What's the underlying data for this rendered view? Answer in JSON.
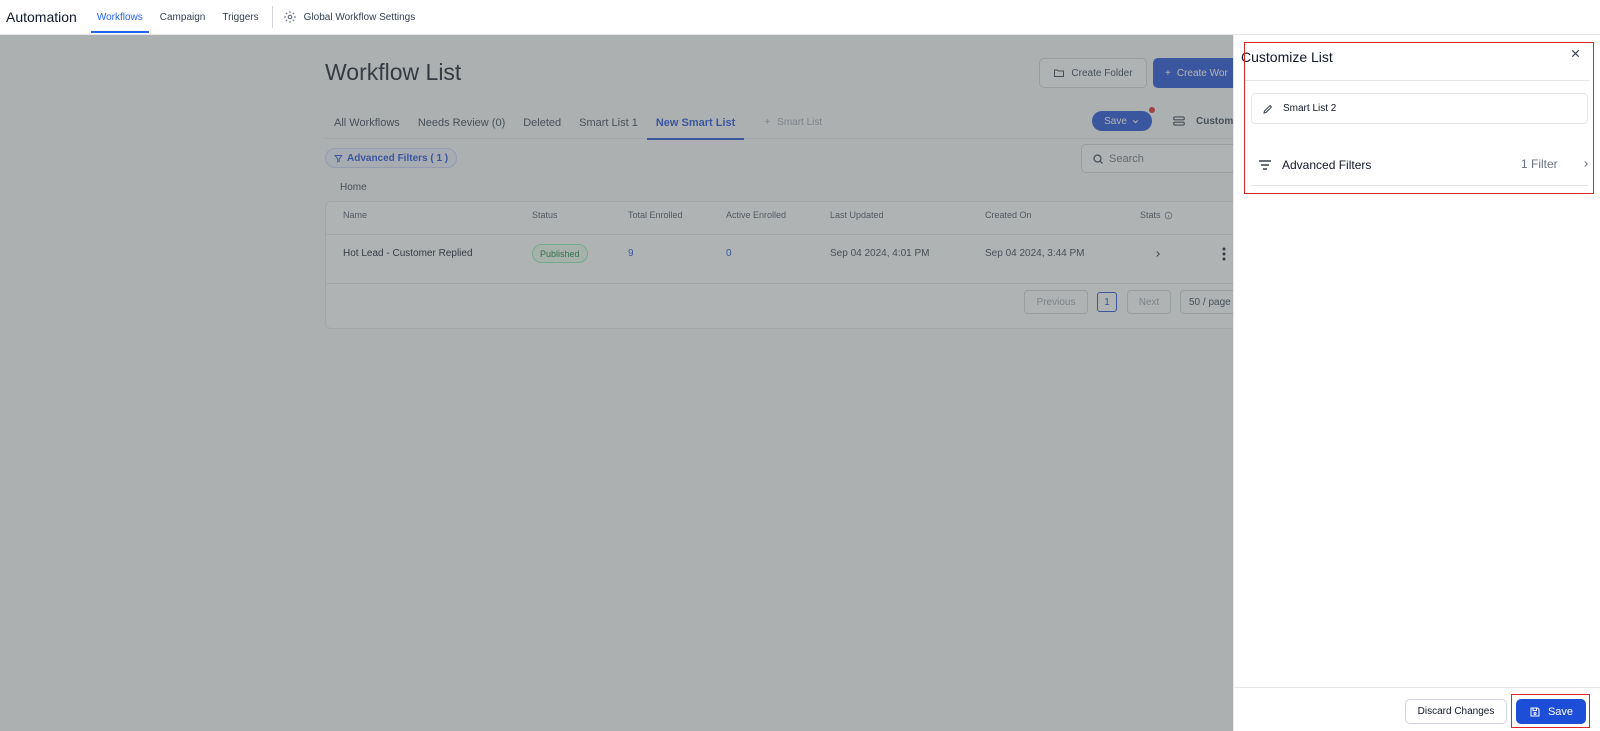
{
  "topnav": {
    "app_title": "Automation",
    "tabs": [
      {
        "label": "Workflows",
        "active": true
      },
      {
        "label": "Campaign",
        "active": false
      },
      {
        "label": "Triggers",
        "active": false
      }
    ],
    "settings_label": "Global Workflow Settings"
  },
  "page": {
    "title": "Workflow List",
    "create_folder_label": "Create Folder",
    "create_workflow_label": "Create Wor"
  },
  "list_tabs": [
    {
      "label": "All Workflows",
      "active": false
    },
    {
      "label": "Needs Review (0)",
      "active": false
    },
    {
      "label": "Deleted",
      "active": false
    },
    {
      "label": "Smart List 1",
      "active": false
    },
    {
      "label": "New Smart List",
      "active": true
    }
  ],
  "add_smart_list_label": "Smart List",
  "toolbar": {
    "save_label": "Save",
    "customize_label": "Custom"
  },
  "filters": {
    "chip_label": "Advanced Filters ( 1 )",
    "search_placeholder": "Search"
  },
  "breadcrumb": "Home",
  "table": {
    "headers": [
      "Name",
      "Status",
      "Total Enrolled",
      "Active Enrolled",
      "Last Updated",
      "Created On",
      "Stats"
    ],
    "rows": [
      {
        "name": "Hot Lead - Customer Replied",
        "status": "Published",
        "total_enrolled": "9",
        "active_enrolled": "0",
        "last_updated": "Sep 04 2024, 4:01 PM",
        "created_on": "Sep 04 2024, 3:44 PM"
      }
    ]
  },
  "pagination": {
    "previous_label": "Previous",
    "current_page": "1",
    "next_label": "Next",
    "page_size": "50 / page"
  },
  "drawer": {
    "title": "Customize List",
    "list_name": "Smart List 2",
    "advanced_filters_label": "Advanced Filters",
    "advanced_filters_count": "1 Filter",
    "discard_label": "Discard Changes",
    "save_label": "Save"
  },
  "colors": {
    "primary": "#1d4ed8",
    "highlight": "#dc2626",
    "overlay": "#5a6060"
  }
}
